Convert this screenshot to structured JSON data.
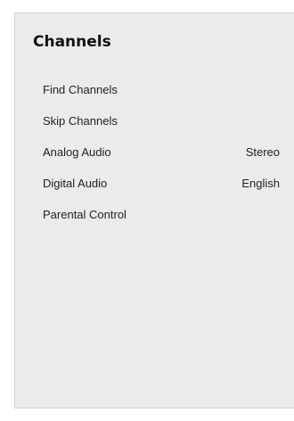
{
  "panel": {
    "title": "Channels"
  },
  "menu": {
    "items": [
      {
        "label": "Find Channels",
        "value": ""
      },
      {
        "label": "Skip Channels",
        "value": ""
      },
      {
        "label": "Analog Audio",
        "value": "Stereo"
      },
      {
        "label": "Digital Audio",
        "value": "English"
      },
      {
        "label": "Parental Control",
        "value": ""
      }
    ]
  }
}
